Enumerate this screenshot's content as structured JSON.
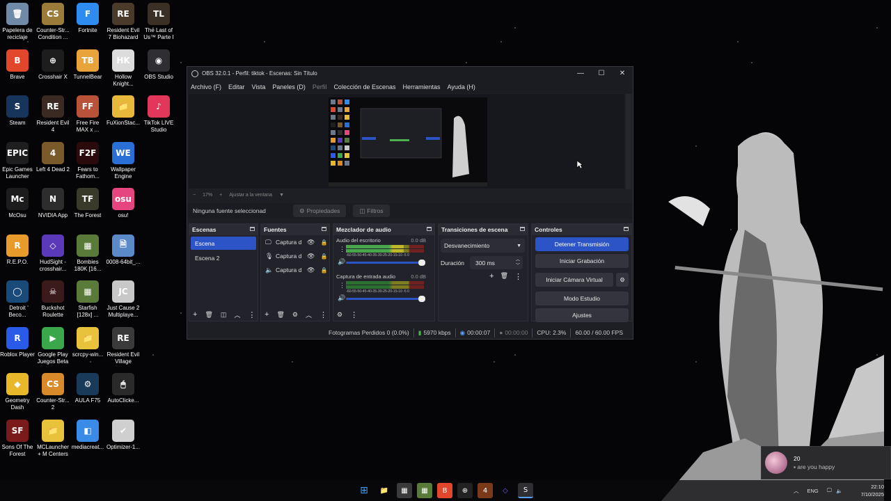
{
  "desktop": {
    "icons": [
      {
        "label": "Papelera de\nreciclaje",
        "color": "#6f8aa6",
        "glyph": "🗑"
      },
      {
        "label": "Counter-Str...\nCondition ...",
        "color": "#9a7b3a",
        "glyph": "CS"
      },
      {
        "label": "Fortnite",
        "color": "#2e8bef",
        "glyph": "F"
      },
      {
        "label": "Resident Evil\n7 Biohazard",
        "color": "#4a3a2a",
        "glyph": "RE"
      },
      {
        "label": "The Last of\nUs™ Parte I",
        "color": "#3a3026",
        "glyph": "TL"
      },
      {
        "label": "Brave",
        "color": "#e2472b",
        "glyph": "B"
      },
      {
        "label": "Crosshair X",
        "color": "#1d1d1d",
        "glyph": "⊕"
      },
      {
        "label": "TunnelBear",
        "color": "#e8a33a",
        "glyph": "TB"
      },
      {
        "label": "Hollow\nKnight...",
        "color": "#dcdcdc",
        "glyph": "HK"
      },
      {
        "label": "OBS Studio",
        "color": "#2f2f33",
        "glyph": "◉"
      },
      {
        "label": "Steam",
        "color": "#17355a",
        "glyph": "S"
      },
      {
        "label": "Resident Evil\n4",
        "color": "#3a2a22",
        "glyph": "RE"
      },
      {
        "label": "Free Fire\nMAX x ...",
        "color": "#b8533a",
        "glyph": "FF"
      },
      {
        "label": "FuXionStac...",
        "color": "#e8b83a",
        "glyph": "📁"
      },
      {
        "label": "TikTok LIVE\nStudio",
        "color": "#e2375a",
        "glyph": "♪"
      },
      {
        "label": "Epic Games\nLauncher",
        "color": "#1e1e1e",
        "glyph": "EPIC"
      },
      {
        "label": "Left 4 Dead 2",
        "color": "#7a5a2a",
        "glyph": "4"
      },
      {
        "label": "Fears to\nFathom...",
        "color": "#2a0a0a",
        "glyph": "F2F"
      },
      {
        "label": "Wallpaper\nEngine",
        "color": "#2a6fd6",
        "glyph": "WE"
      },
      {
        "label": "McOsu",
        "color": "#1c1c1c",
        "glyph": "Mc"
      },
      {
        "label": "NVIDIA App",
        "color": "#2d2d2d",
        "glyph": "N"
      },
      {
        "label": "The Forest",
        "color": "#3a3a2a",
        "glyph": "TF"
      },
      {
        "label": "osu!",
        "color": "#e6457f",
        "glyph": "osu"
      },
      {
        "label": "R.E.P.O.",
        "color": "#e89a2a",
        "glyph": "R"
      },
      {
        "label": "HudSight -\ncrosshair...",
        "color": "#5a3ab8",
        "glyph": "◇"
      },
      {
        "label": "Bombies\n180K [16...",
        "color": "#5a7a3a",
        "glyph": "▦"
      },
      {
        "label": "0008-64bit_...",
        "color": "#5a8ac8",
        "glyph": "🗎"
      },
      {
        "label": "Detroit\nBeco...",
        "color": "#1a4a7a",
        "glyph": "◯"
      },
      {
        "label": "Buckshot\nRoulette",
        "color": "#3a1a1a",
        "glyph": "☠"
      },
      {
        "label": "Starfish\n[128x] ...",
        "color": "#5a7a3a",
        "glyph": "▦"
      },
      {
        "label": "Just Cause 2\nMultiplaye...",
        "color": "#c8c8c8",
        "glyph": "JC"
      },
      {
        "label": "Roblox Player",
        "color": "#2a5ae8",
        "glyph": "R"
      },
      {
        "label": "Google Play\nJuegos Beta",
        "color": "#3aa84a",
        "glyph": "▶"
      },
      {
        "label": "scrcpy-win...",
        "color": "#e8c23a",
        "glyph": "📁"
      },
      {
        "label": "Resident Evil\nVillage",
        "color": "#3a3a3a",
        "glyph": "RE"
      },
      {
        "label": "Geometry\nDash",
        "color": "#e8b82a",
        "glyph": "◆"
      },
      {
        "label": "Counter-Str...\n2",
        "color": "#d88a2a",
        "glyph": "CS"
      },
      {
        "label": "AULA F75",
        "color": "#1a3a5a",
        "glyph": "⚙"
      },
      {
        "label": "AutoClicke...",
        "color": "#2a2a2a",
        "glyph": "🖱"
      },
      {
        "label": "Sons Of The\nForest",
        "color": "#7a1a1a",
        "glyph": "SF"
      },
      {
        "label": "MCLauncher\n+ M Centers",
        "color": "#e8c23a",
        "glyph": "📁"
      },
      {
        "label": "mediacreat...",
        "color": "#3a8ae8",
        "glyph": "◧"
      },
      {
        "label": "Optimizer-1...",
        "color": "#cfcfcf",
        "glyph": "✔"
      }
    ]
  },
  "obs": {
    "title": "OBS 32.0.1 - Perfil: tiktok - Escenas: Sin Título",
    "window_controls": {
      "minimize": "—",
      "maximize": "☐",
      "close": "✕"
    },
    "menu": [
      "Archivo (F)",
      "Editar",
      "Vista",
      "Paneles (D)",
      "Perfil",
      "Colección de Escenas",
      "Herramientas",
      "Ayuda (H)"
    ],
    "zoom": {
      "minus": "−",
      "value": "17%",
      "plus": "+",
      "fit": "Ajustar a la ventana"
    },
    "source_toolbar": {
      "none_selected": "Ninguna fuente seleccionad",
      "properties": "Propiedades",
      "filters": "Filtros"
    },
    "scenes": {
      "title": "Escenas",
      "items": [
        "Escena",
        "Escena 2"
      ],
      "selected": 0
    },
    "sources": {
      "title": "Fuentes",
      "items": [
        {
          "icon": "🖵",
          "label": "Captura d"
        },
        {
          "icon": "🎙",
          "label": "Captura d"
        },
        {
          "icon": "🔈",
          "label": "Captura d"
        }
      ]
    },
    "mixer": {
      "title": "Mezclador de audio",
      "channels": [
        {
          "name": "Audio del escritorio",
          "db": "0.0 dB",
          "level": 0.74
        },
        {
          "name": "Captura de entrada audio",
          "db": "0.0 dB",
          "level": 0
        }
      ],
      "ticks": "-60-55-50-45-40-35-30-25-20-15-10 -5 0"
    },
    "transitions": {
      "title": "Transiciones de escena",
      "selected": "Desvanecimiento",
      "duration_label": "Duración",
      "duration_value": "300 ms"
    },
    "controls": {
      "title": "Controles",
      "stream": "Detener Transmisión",
      "record": "Iniciar Grabación",
      "virtualcam": "Iniciar Cámara Virtual",
      "studio": "Modo Estudio",
      "settings": "Ajustes"
    },
    "status": {
      "dropped": "Fotogramas Perdidos 0 (0.0%)",
      "bitrate": "5970 kbps",
      "stream_time": "00:00:07",
      "rec_time": "00:00:00",
      "cpu": "CPU: 2.3%",
      "fps": "60.00 / 60.00 FPS"
    }
  },
  "notification": {
    "title": "20",
    "message": "are you happy"
  },
  "tray": {
    "lang": "ENG",
    "time": "22:10",
    "date": "7/10/2025"
  }
}
